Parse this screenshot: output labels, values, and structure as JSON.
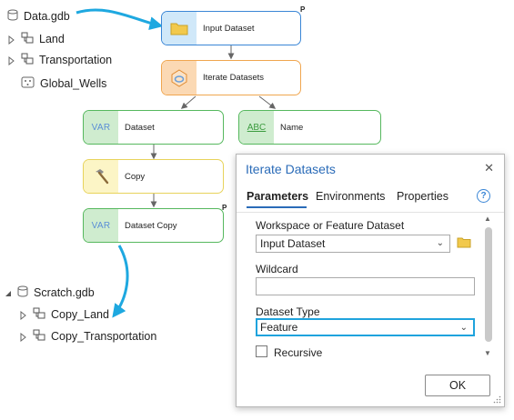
{
  "catalog": {
    "top_gdb": "Data.gdb",
    "top_items": [
      "Land",
      "Transportation",
      "Global_Wells"
    ],
    "scratch_gdb": "Scratch.gdb",
    "scratch_items": [
      "Copy_Land",
      "Copy_Transportation"
    ]
  },
  "model": {
    "input_dataset": "Input Dataset",
    "iterate_datasets": "Iterate Datasets",
    "dataset": "Dataset",
    "name": "Name",
    "copy": "Copy",
    "dataset_copy": "Dataset Copy",
    "var_icon_text": "VAR",
    "abc_icon_text": "ABC",
    "parameter_marker": "P"
  },
  "dialog": {
    "title": "Iterate Datasets",
    "tabs": [
      "Parameters",
      "Environments",
      "Properties"
    ],
    "active_tab": "Parameters",
    "workspace_label": "Workspace or Feature Dataset",
    "workspace_value": "Input Dataset",
    "wildcard_label": "Wildcard",
    "wildcard_value": "",
    "dataset_type_label": "Dataset Type",
    "dataset_type_value": "Feature",
    "recursive_label": "Recursive",
    "recursive_checked": false,
    "ok_label": "OK"
  },
  "colors": {
    "accent": "#2a6bb8",
    "arrow": "#1ea8e0",
    "input_node": "#3a86d6",
    "iterator_node": "#f0a64f",
    "variable_node": "#56b85e",
    "tool_node": "#e8d35b",
    "focus_border": "#1fa3dd"
  }
}
